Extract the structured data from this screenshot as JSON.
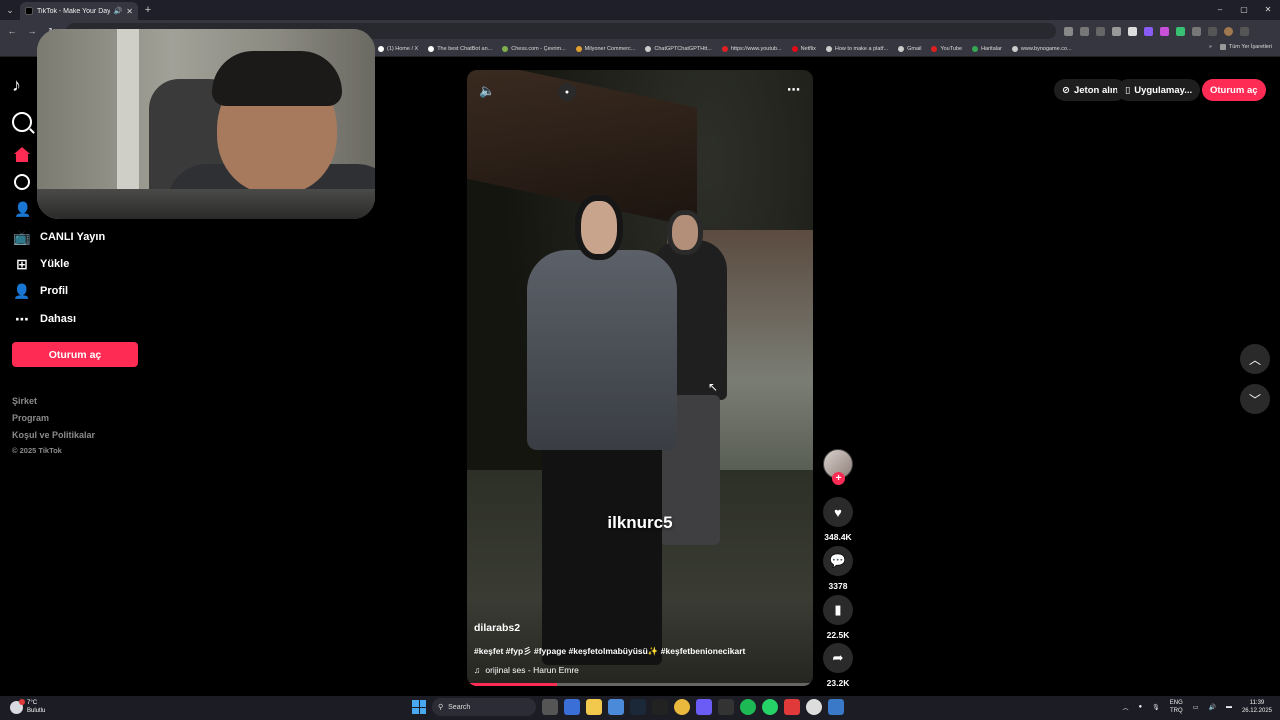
{
  "browser": {
    "tab_title": "TikTok - Make Your Day",
    "tab_close": "✕",
    "new_tab": "+",
    "window_controls": [
      "–",
      "▢",
      "✕"
    ],
    "bookmarks": [
      {
        "label": "(1) Home / X",
        "color": "#ffffff"
      },
      {
        "label": "The best ChatBot an...",
        "color": "#ffffff"
      },
      {
        "label": "Chess.com - Çevrim...",
        "color": "#7fb04c"
      },
      {
        "label": "Milyoner Commerc...",
        "color": "#e0a030"
      },
      {
        "label": "ChatGPTChatGPTHtt...",
        "color": "#cccccc"
      },
      {
        "label": "https://www.youtub...",
        "color": "#e02020"
      },
      {
        "label": "Netflix",
        "color": "#e50914"
      },
      {
        "label": "How to make a platf...",
        "color": "#cccccc"
      },
      {
        "label": "Gmail",
        "color": "#cccccc"
      },
      {
        "label": "YouTube",
        "color": "#e02020"
      },
      {
        "label": "Haritalar",
        "color": "#34a853"
      },
      {
        "label": "www.bynogame.co...",
        "color": "#cccccc"
      }
    ],
    "bookmarks_more": "»",
    "all_bookmarks": "Tüm Yer İşaretleri"
  },
  "sidebar": {
    "items": [
      {
        "label": "CANLI Yayın",
        "icon": "live-icon"
      },
      {
        "label": "Yükle",
        "icon": "upload-icon"
      },
      {
        "label": "Profil",
        "icon": "profile-icon"
      },
      {
        "label": "Dahası",
        "icon": "more-icon"
      }
    ],
    "login_label": "Oturum aç",
    "footer": [
      "Şirket",
      "Program",
      "Koşul ve Politikalar"
    ],
    "copyright": "© 2025 TikTok"
  },
  "topbar": {
    "coins": "Jeton alın",
    "app": "Uygulamay...",
    "login": "Oturum aç"
  },
  "video": {
    "overlay_text": "ilknurc5",
    "author": "dilarabs2",
    "caption": "#keşfet #fyp彡 #fypage #keşfetolmabüyüsü✨  #keşfetbenionecikart",
    "music": "orijinal ses - Harun Emre",
    "progress": 0.26
  },
  "actions": {
    "likes": "348.4K",
    "comments": "3378",
    "saves": "22.5K",
    "shares": "23.2K"
  },
  "taskbar": {
    "temp": "7°C",
    "weather": "Bulutlu",
    "search": "Search",
    "lang_top": "ENG",
    "lang_bottom": "TRQ",
    "time": "11:39",
    "date": "26.12.2025"
  },
  "colors": {
    "accent": "#fe2c55",
    "background": "#000000"
  }
}
